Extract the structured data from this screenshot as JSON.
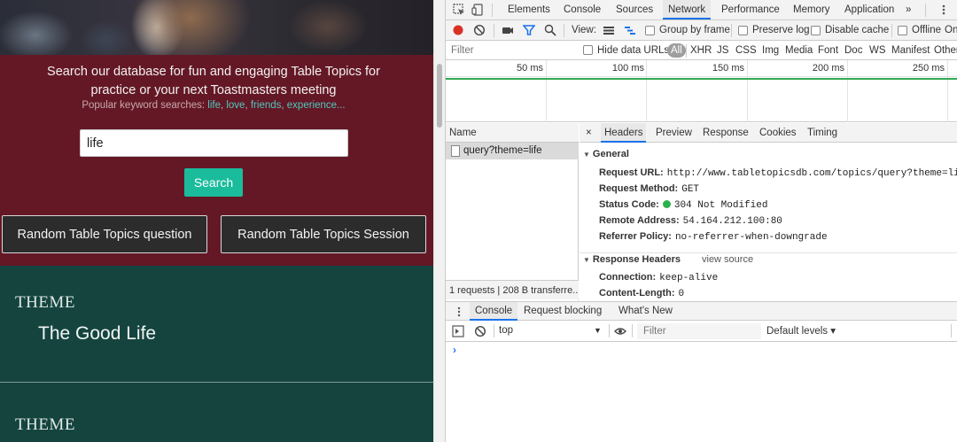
{
  "site": {
    "hero_line1": "Search our database for fun and engaging Table Topics for",
    "hero_line2": "practice or your next Toastmasters meeting",
    "popular_prefix": "Popular keyword searches:",
    "popular_keywords": [
      "life",
      "love",
      "friends",
      "experience..."
    ],
    "search_value": "life",
    "search_button": "Search",
    "random_question_button": "Random Table Topics question",
    "random_session_button": "Random Table Topics Session",
    "themes": [
      {
        "label": "THEME",
        "title": "The Good Life"
      },
      {
        "label": "THEME",
        "title": ""
      }
    ],
    "colors": {
      "hero_band": "#641825",
      "theme_bg": "#15443f",
      "accent": "#1abc9c",
      "keyword_link": "#4fc8c0"
    }
  },
  "devtools": {
    "main_tabs": [
      "Elements",
      "Console",
      "Sources",
      "Network",
      "Performance",
      "Memory",
      "Application",
      "»"
    ],
    "active_main_tab": "Network",
    "toolbar": {
      "view_label": "View:",
      "group_by_frame": "Group by frame",
      "preserve_log": "Preserve log",
      "disable_cache": "Disable cache",
      "offline": "Offline",
      "online_truncated": "On"
    },
    "filter": {
      "placeholder": "Filter",
      "hide_data_urls": "Hide data URLs",
      "types": [
        "All",
        "XHR",
        "JS",
        "CSS",
        "Img",
        "Media",
        "Font",
        "Doc",
        "WS",
        "Manifest",
        "Other"
      ],
      "active_type": "All"
    },
    "timeline_ticks": [
      "50 ms",
      "100 ms",
      "150 ms",
      "200 ms",
      "250 ms"
    ],
    "request_list": {
      "header": "Name",
      "rows": [
        "query?theme=life"
      ],
      "summary": "1 requests | 208 B transferre..."
    },
    "detail_tabs": [
      "×",
      "Headers",
      "Preview",
      "Response",
      "Cookies",
      "Timing"
    ],
    "active_detail_tab": "Headers",
    "general": {
      "title": "General",
      "items": [
        {
          "key": "Request URL:",
          "value": "http://www.tabletopicsdb.com/topics/query?theme=life"
        },
        {
          "key": "Request Method:",
          "value": "GET"
        },
        {
          "key": "Status Code:",
          "value": "304 Not Modified"
        },
        {
          "key": "Remote Address:",
          "value": "54.164.212.100:80"
        },
        {
          "key": "Referrer Policy:",
          "value": "no-referrer-when-downgrade"
        }
      ]
    },
    "response_headers": {
      "title": "Response Headers",
      "view_source": "view source",
      "items": [
        {
          "key": "Connection:",
          "value": "keep-alive"
        },
        {
          "key": "Content-Length:",
          "value": "0"
        }
      ]
    },
    "drawer_tabs": [
      "Console",
      "Request blocking",
      "What's New"
    ],
    "active_drawer_tab": "Console",
    "console": {
      "context": "top",
      "filter_placeholder": "Filter",
      "levels": "Default levels ▾",
      "prompt": "›"
    },
    "colors": {
      "active_tab_underline": "#1a73e8",
      "record": "#d93025",
      "status_ok": "#2bb24c",
      "timeline_bar": "#33a852"
    }
  }
}
